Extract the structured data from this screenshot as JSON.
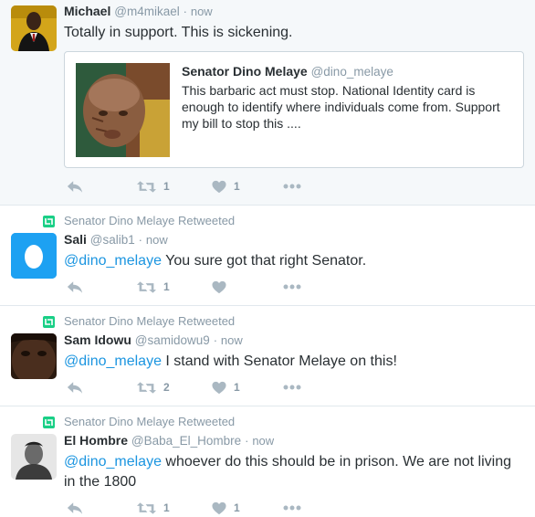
{
  "tweets": [
    {
      "retweet_context": "",
      "name": "Michael",
      "handle": "@m4mikael",
      "dot": "·",
      "time": "now",
      "text": "Totally in support. This is sickening.",
      "mention": "",
      "quote": {
        "name": "Senator Dino Melaye",
        "handle": "@dino_melaye",
        "text": "This barbaric act must stop. National Identity card is enough to identify where individuals come from. Support my bill to stop this ...."
      },
      "retweets": "1",
      "likes": "1"
    },
    {
      "retweet_context": "Senator Dino Melaye Retweeted",
      "name": "Sali",
      "handle": "@salib1",
      "dot": "·",
      "time": "now",
      "mention": "@dino_melaye",
      "text": " You sure got that right Senator.",
      "retweets": "1",
      "likes": ""
    },
    {
      "retweet_context": "Senator Dino Melaye Retweeted",
      "name": "Sam Idowu",
      "handle": "@samidowu9",
      "dot": "·",
      "time": "now",
      "mention": "@dino_melaye",
      "text": " I stand with Senator Melaye on this!",
      "retweets": "2",
      "likes": "1"
    },
    {
      "retweet_context": "Senator Dino Melaye Retweeted",
      "name": "El Hombre",
      "handle": "@Baba_El_Hombre",
      "dot": "·",
      "time": "now",
      "mention": "@dino_melaye",
      "text": " whoever do this should be in prison. We are not living in the 1800",
      "retweets": "1",
      "likes": "1"
    }
  ],
  "icons": {
    "reply": "reply-icon",
    "retweet": "retweet-icon",
    "like": "heart-icon",
    "more": "more-icon",
    "retweet_badge": "retweet-badge-icon"
  },
  "colors": {
    "link": "#1b95e0",
    "muted": "#8899a6",
    "icon": "#aab8c2",
    "retweet_green": "#19cf86",
    "highlight_bg": "#f5f8fa"
  }
}
